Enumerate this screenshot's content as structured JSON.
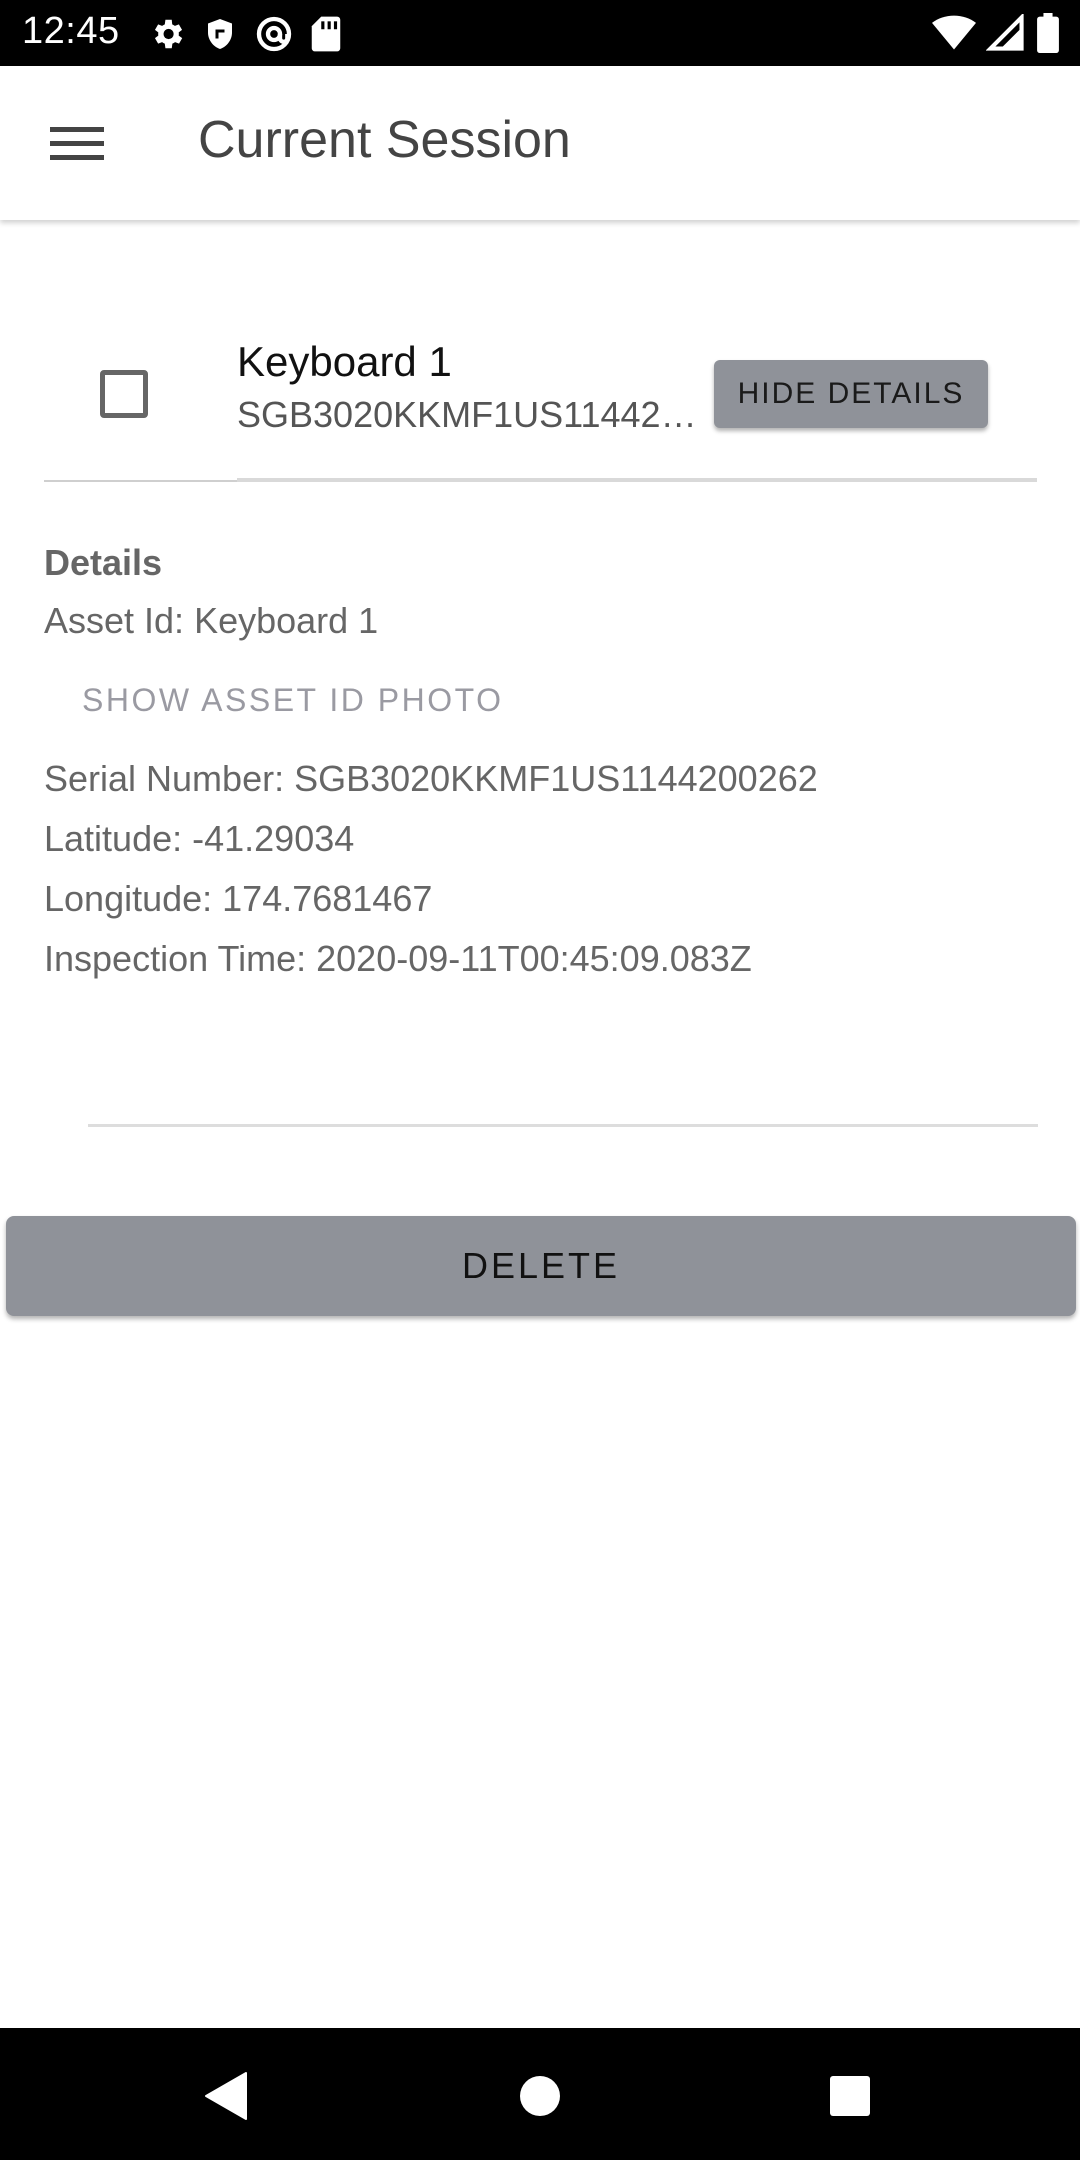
{
  "status_bar": {
    "time": "12:45",
    "left_icons": [
      "gear-icon",
      "shield-icon",
      "at-sign-icon",
      "sd-card-icon"
    ],
    "right_icons": [
      "wifi-icon",
      "signal-icon",
      "battery-icon"
    ]
  },
  "app_bar": {
    "title": "Current Session",
    "menu_icon": "menu-icon"
  },
  "item": {
    "title": "Keyboard 1",
    "subtitle": "SGB3020KKMF1US1144200262",
    "hide_details_label": "HIDE DETAILS",
    "checked": false
  },
  "details": {
    "heading": "Details",
    "asset_id": "Asset Id: Keyboard 1",
    "show_photo_label": "SHOW ASSET ID PHOTO",
    "serial": "Serial Number: SGB3020KKMF1US1144200262",
    "latitude": "Latitude: -41.29034",
    "longitude": "Longitude: 174.7681467",
    "inspection_time": "Inspection Time: 2020-09-11T00:45:09.083Z"
  },
  "delete_label": "DELETE",
  "nav_bar": {
    "icons": [
      "back-icon",
      "home-icon",
      "recents-icon"
    ]
  },
  "colors": {
    "button_gray": "#8f9299",
    "text_gray": "#666666",
    "status_bar": "#000000"
  }
}
